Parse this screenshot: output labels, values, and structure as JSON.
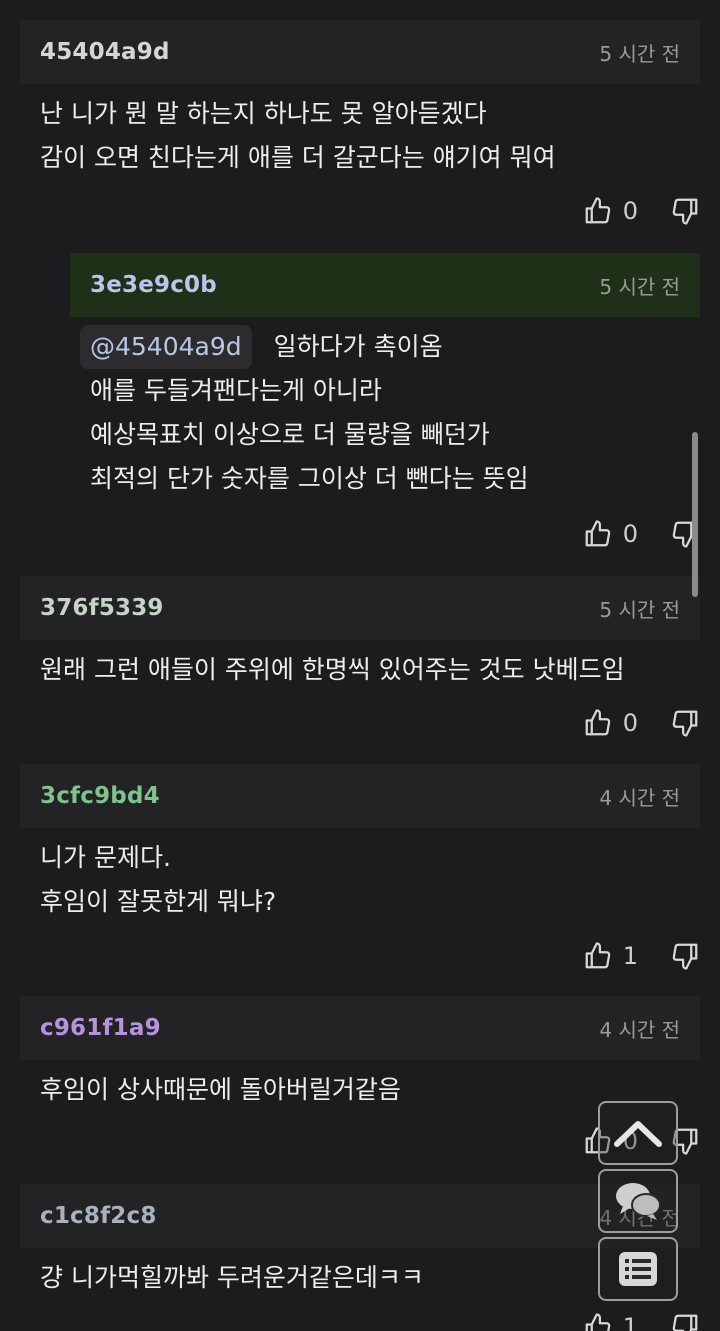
{
  "comments": [
    {
      "author": "45404a9d",
      "author_color": "#d6d6d6",
      "time": "5 시간 전",
      "lines": [
        "난 니가 뭔 말 하는지 하나도 못 알아듣겠다",
        "감이 오면 친다는게 애를 더 갈군다는 얘기여 뭐여"
      ],
      "likes": "0"
    },
    {
      "author": "3e3e9c0b",
      "author_color": "#b9c6ec",
      "time": "5 시간 전",
      "mention": "@45404a9d",
      "lines": [
        "일하다가 촉이옴",
        "애를 두들겨팬다는게 아니라",
        "예상목표치 이상으로 더 물량을 빼던가",
        "최적의 단가 숫자를 그이상 더 뺀다는 뜻임"
      ],
      "likes": "0"
    },
    {
      "author": "376f5339",
      "author_color": "#c6d3c6",
      "time": "5 시간 전",
      "lines": [
        "원래 그런 애들이 주위에 한명씩 있어주는 것도 낫베드임"
      ],
      "likes": "0"
    },
    {
      "author": "3cfc9bd4",
      "author_color": "#7fc38d",
      "time": "4 시간 전",
      "lines": [
        "니가 문제다.",
        "후임이 잘못한게 뭐냐?"
      ],
      "likes": "1"
    },
    {
      "author": "c961f1a9",
      "author_color": "#b693dc",
      "time": "4 시간 전",
      "lines": [
        "후임이 상사때문에 돌아버릴거같음"
      ],
      "likes": "0"
    },
    {
      "author": "c1c8f2c8",
      "author_color": "#a9b1bd",
      "time": "4 시간 전",
      "lines": [
        "걍 니가먹힐까봐 두려운거같은데ㅋㅋ"
      ],
      "likes": "1"
    }
  ],
  "icons": {
    "like": "thumbs-up-icon",
    "dislike": "thumbs-down-icon",
    "scroll_top": "chevron-up-icon",
    "comments": "chat-bubbles-icon",
    "list": "list-icon"
  }
}
